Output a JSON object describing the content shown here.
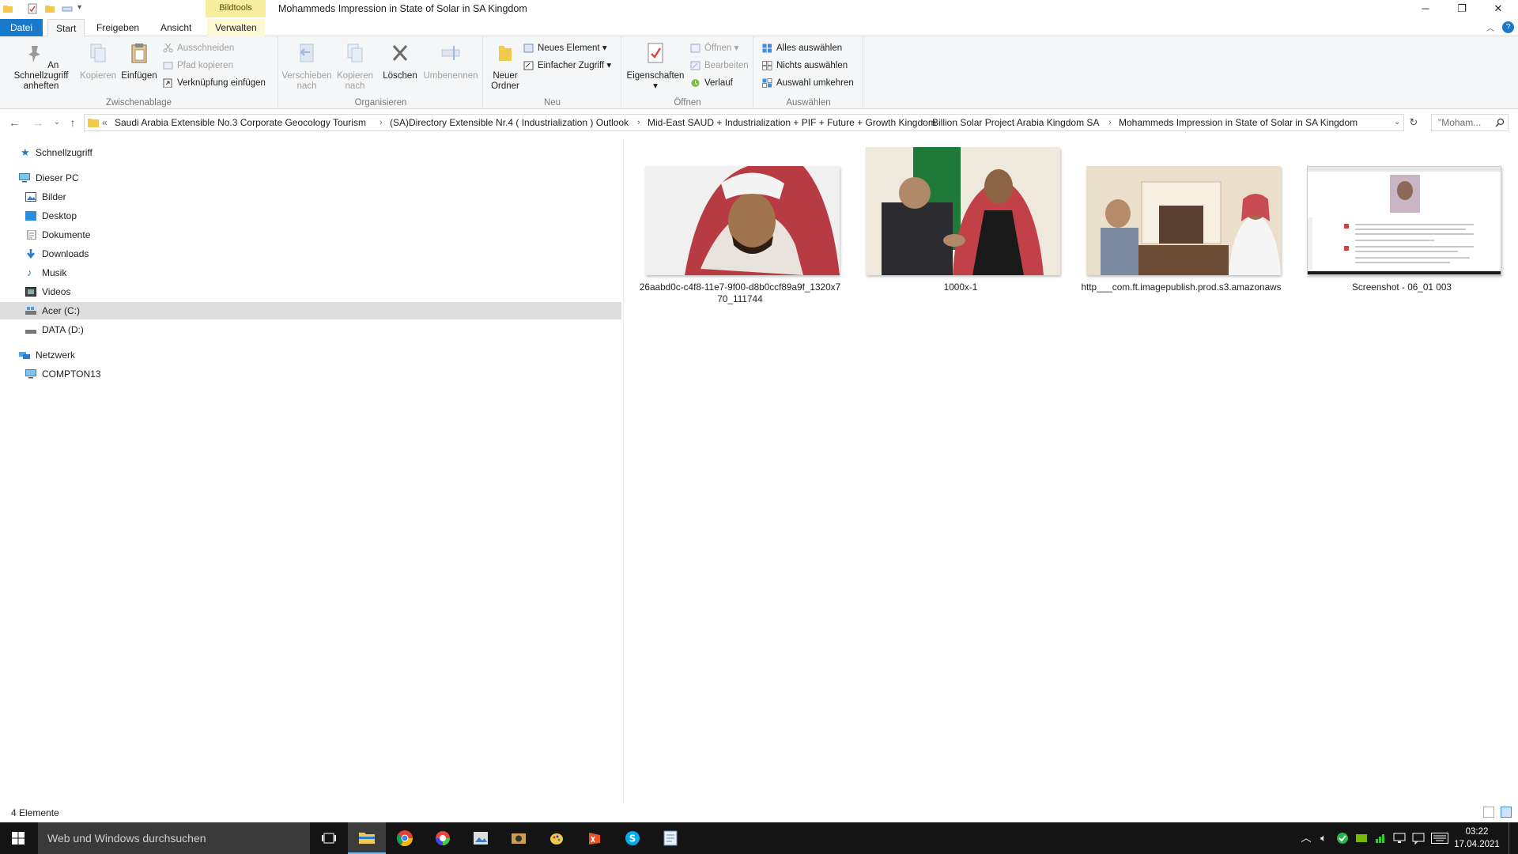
{
  "window": {
    "title": "Mohammeds Impression in State of Solar in SA Kingdom",
    "contextual_tab_group": "Bildtools"
  },
  "tabs": [
    "Datei",
    "Start",
    "Freigeben",
    "Ansicht",
    "Verwalten"
  ],
  "ribbon": {
    "clipboard": {
      "label": "Zwischenablage",
      "pin_label": "An Schnellzugriff anheften",
      "copy_label": "Kopieren",
      "paste_label": "Einfügen",
      "cut_label": "Ausschneiden",
      "copy_path_label": "Pfad kopieren",
      "paste_shortcut_label": "Verknüpfung einfügen"
    },
    "organize": {
      "label": "Organisieren",
      "move_label": "Verschieben nach",
      "copyto_label": "Kopieren nach",
      "delete_label": "Löschen",
      "rename_label": "Umbenennen"
    },
    "new": {
      "label": "Neu",
      "new_folder_label": "Neuer Ordner",
      "new_item_label": "Neues Element",
      "easy_access_label": "Einfacher Zugriff"
    },
    "open": {
      "label": "Öffnen",
      "properties_label": "Eigenschaften",
      "open_label": "Öffnen",
      "edit_label": "Bearbeiten",
      "history_label": "Verlauf"
    },
    "select": {
      "label": "Auswählen",
      "select_all_label": "Alles auswählen",
      "select_none_label": "Nichts auswählen",
      "invert_label": "Auswahl umkehren"
    }
  },
  "address": {
    "overflow": "«",
    "crumbs": [
      "Saudi Arabia Extensible No.3 Corporate Geocology Tourism",
      "(SA)Directory Extensible Nr.4 ( Industrialization )  Outlook",
      "Mid-East SAUD + Industrialization + PIF + Future + Growth Kingdom",
      "Billion Solar Project Arabia Kingdom SA",
      "Mohammeds Impression in State of Solar in SA Kingdom"
    ],
    "search_placeholder": "\"Moham..."
  },
  "navpane": {
    "quick_access": "Schnellzugriff",
    "this_pc": "Dieser PC",
    "pc_items": [
      "Bilder",
      "Desktop",
      "Dokumente",
      "Downloads",
      "Musik",
      "Videos",
      "Acer (C:)",
      "DATA (D:)"
    ],
    "network": "Netzwerk",
    "network_items": [
      "COMPTON13"
    ]
  },
  "files": [
    {
      "name": "26aabd0c-c4f8-11e7-9f00-d8b0ccf89a9f_1320x770_111744"
    },
    {
      "name": "1000x-1"
    },
    {
      "name": "http___com.ft.imagepublish.prod.s3.amazonaws"
    },
    {
      "name": "Screenshot - 06_01 003"
    }
  ],
  "status": {
    "count": "4 Elemente"
  },
  "taskbar": {
    "search_placeholder": "Web und Windows durchsuchen",
    "time": "03:22",
    "date": "17.04.2021"
  },
  "colors": {
    "accent": "#1979ca",
    "selection": "#dedede",
    "taskbar": "#141414"
  }
}
